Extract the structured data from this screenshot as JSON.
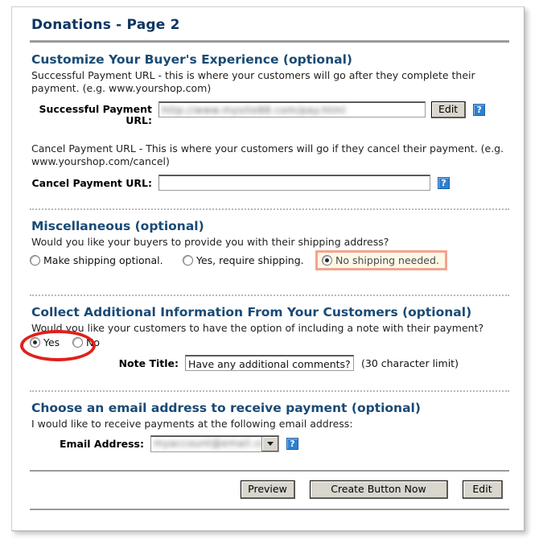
{
  "page": {
    "title": "Donations - Page 2"
  },
  "sections": {
    "customize": {
      "heading": "Customize Your Buyer's Experience (optional)",
      "success_desc": "Successful Payment URL - this is where your customers will go after they complete their payment. (e.g. www.yourshop.com)",
      "success_label": "Successful Payment URL:",
      "success_value": "http://www.mysite88.com/pay.html",
      "edit_label": "Edit",
      "help_glyph": "?",
      "cancel_desc": "Cancel Payment URL - This is where your customers will go if they cancel their payment. (e.g. www.yourshop.com/cancel)",
      "cancel_label": "Cancel Payment URL:",
      "cancel_value": "",
      "cancel_placeholder": ""
    },
    "misc": {
      "heading": "Miscellaneous (optional)",
      "question": "Would you like your buyers to provide you with their shipping address?",
      "options": [
        {
          "label": "Make shipping optional.",
          "checked": false
        },
        {
          "label": "Yes, require shipping.",
          "checked": false
        },
        {
          "label": "No shipping needed.",
          "checked": true
        }
      ]
    },
    "collect": {
      "heading": "Collect Additional Information From Your Customers (optional)",
      "question": "Would you like your customers to have the option of including a note with their payment?",
      "options": [
        {
          "label": "Yes",
          "checked": true
        },
        {
          "label": "No",
          "checked": false
        }
      ],
      "note_label": "Note Title:",
      "note_value": "Have any additional comments?",
      "note_hint": "(30 character limit)"
    },
    "email": {
      "heading": "Choose an email address to receive payment (optional)",
      "desc": "I would like to receive payments at the following email address:",
      "label": "Email Address:",
      "selected": "myaccount@email.com",
      "help_glyph": "?"
    }
  },
  "footer": {
    "preview_label": "Preview",
    "create_label": "Create Button Now",
    "edit_label": "Edit"
  },
  "colors": {
    "heading": "#1a4a75",
    "title": "#0d3560",
    "help_blue": "#2f7fd0",
    "highlight_border": "#f4a391",
    "highlight_bg": "#fdf8e6",
    "annotation_red": "#e0201b",
    "button_face": "#d9d6ce"
  }
}
